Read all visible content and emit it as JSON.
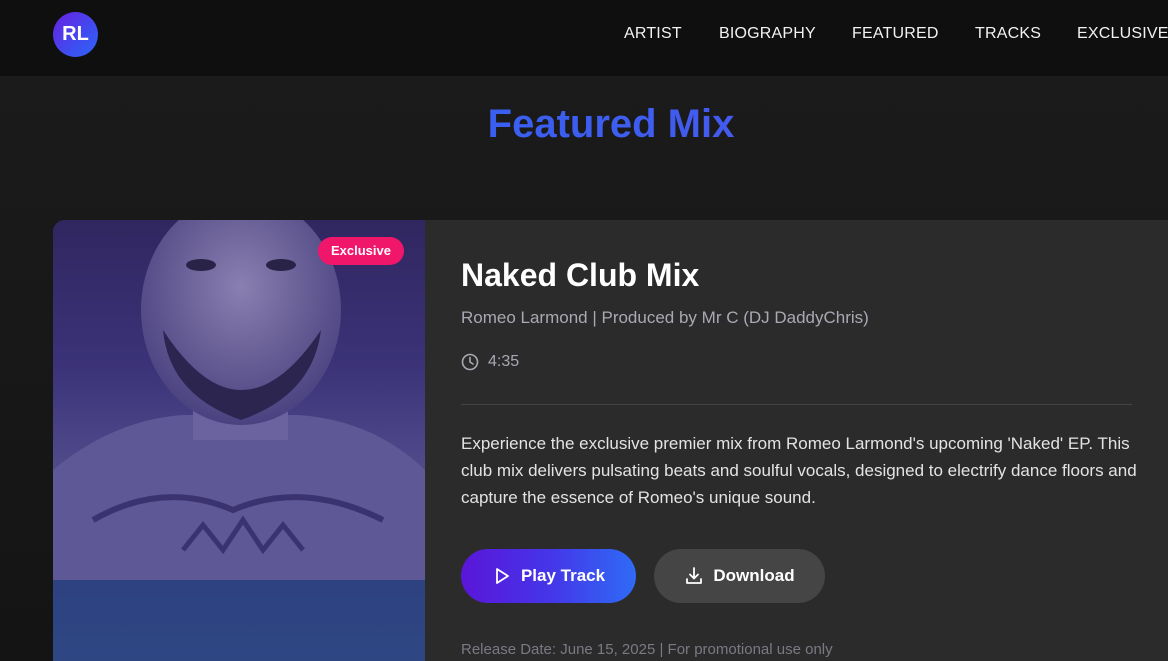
{
  "header": {
    "logo_text": "RL",
    "nav": [
      {
        "label": "ARTIST"
      },
      {
        "label": "BIOGRAPHY"
      },
      {
        "label": "FEATURED"
      },
      {
        "label": "TRACKS"
      },
      {
        "label": "EXCLUSIVE"
      }
    ]
  },
  "section": {
    "title": "Featured Mix"
  },
  "card": {
    "badge": "Exclusive",
    "track_title": "Naked Club Mix",
    "credits": "Romeo Larmond | Produced by Mr C (DJ DaddyChris)",
    "duration": "4:35",
    "description": "Experience the exclusive premier mix from Romeo Larmond's upcoming 'Naked' EP. This club mix delivers pulsating beats and soulful vocals, designed to electrify dance floors and capture the essence of Romeo's unique sound.",
    "play_label": "Play Track",
    "download_label": "Download",
    "footnote": "Release Date: June 15, 2025 | For promotional use only"
  },
  "colors": {
    "accent_blue": "#2f6bf6",
    "accent_purple": "#5a16d9",
    "badge_pink": "#f0166a"
  },
  "icons": {
    "clock": "clock-icon",
    "play": "play-icon",
    "download": "download-icon"
  }
}
